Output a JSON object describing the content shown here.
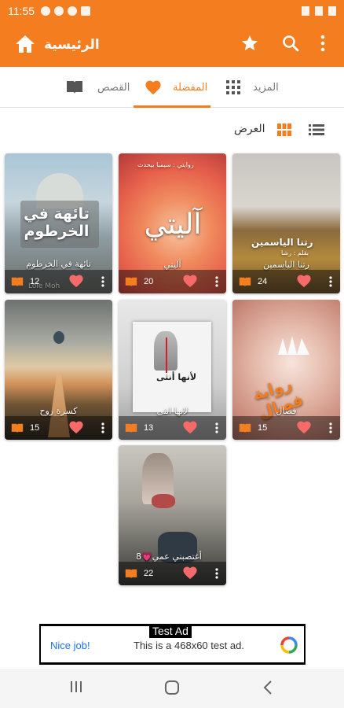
{
  "status_bar": {
    "time": "11:55"
  },
  "app_bar": {
    "title": "الرئيسية",
    "accent_color": "#f47d20"
  },
  "tabs": [
    {
      "label": "المزيد",
      "icon": "grid-icon"
    },
    {
      "label": "المفضلة",
      "icon": "heart-icon",
      "active": true
    },
    {
      "label": "القصص",
      "icon": "book-icon"
    }
  ],
  "view": {
    "label": "العرض",
    "grid_icon": "grid-view-icon",
    "list_icon": "list-view-icon"
  },
  "stories": [
    {
      "title": "تائهة في الخرطوم",
      "count": "12",
      "cover_text": "تائهة في الخرطوم",
      "cover_sub": "Lole Moh"
    },
    {
      "title": "آليتي",
      "count": "20",
      "cover_text": "آليتي",
      "cover_sub": "روايتي : سيمبا بيحدث"
    },
    {
      "title": "رتنا الياسمين",
      "count": "24",
      "cover_text": "رتنا الياسمين",
      "cover_sub": "بقلم : رشا"
    },
    {
      "title": "كسرة روح",
      "count": "15"
    },
    {
      "title": "لانها انثى",
      "count": "13",
      "cover_text": "لأنها أنثى"
    },
    {
      "title": "فصال",
      "count": "15",
      "cover_text": "رواية فصال"
    },
    {
      "title": "أغتصبني عمي💗8",
      "count": "22"
    }
  ],
  "ad": {
    "tag": "Test Ad",
    "nice": "Nice job!",
    "message": "This is a 468x60 test ad."
  }
}
